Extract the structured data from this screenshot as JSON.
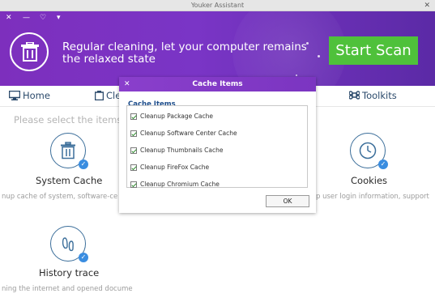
{
  "window": {
    "title": "Youker Assistant",
    "close_glyph": "✕"
  },
  "banner": {
    "message": "Regular cleaning, let your computer remains the relaxed state",
    "scan_button": "Start Scan",
    "controls": {
      "close": "✕",
      "minimize": "—",
      "skin": "♡",
      "menu": "▾"
    }
  },
  "tabs": [
    {
      "label": "Home",
      "icon": "monitor-icon"
    },
    {
      "label": "Cle",
      "icon": "cleanup-icon"
    },
    {
      "label": "Toolkits",
      "icon": "command-icon"
    }
  ],
  "main": {
    "hint": "Please select the items",
    "items": [
      {
        "title": "System Cache",
        "description": "nup  cache of system, software-ce",
        "icon": "trash-icon"
      },
      {
        "title": "Cookies",
        "description": "p user login information, support",
        "icon": "clock-icon"
      },
      {
        "title": "History trace",
        "description": "ning the internet and opened docume",
        "icon": "footprint-icon"
      }
    ]
  },
  "dialog": {
    "title": "Cache Items",
    "close_glyph": "✕",
    "list_title": "Cache Items",
    "options": [
      "Cleanup Package Cache",
      "Cleanup Software Center Cache",
      "Cleanup Thumbnails Cache",
      "Cleanup FireFox Cache",
      "Cleanup Chromium Cache"
    ],
    "ok_button": "OK"
  },
  "colors": {
    "accent": "#7a35c6",
    "scan": "#4fc13b",
    "tab_text": "#2b4a6b",
    "badge": "#3a8de0"
  }
}
